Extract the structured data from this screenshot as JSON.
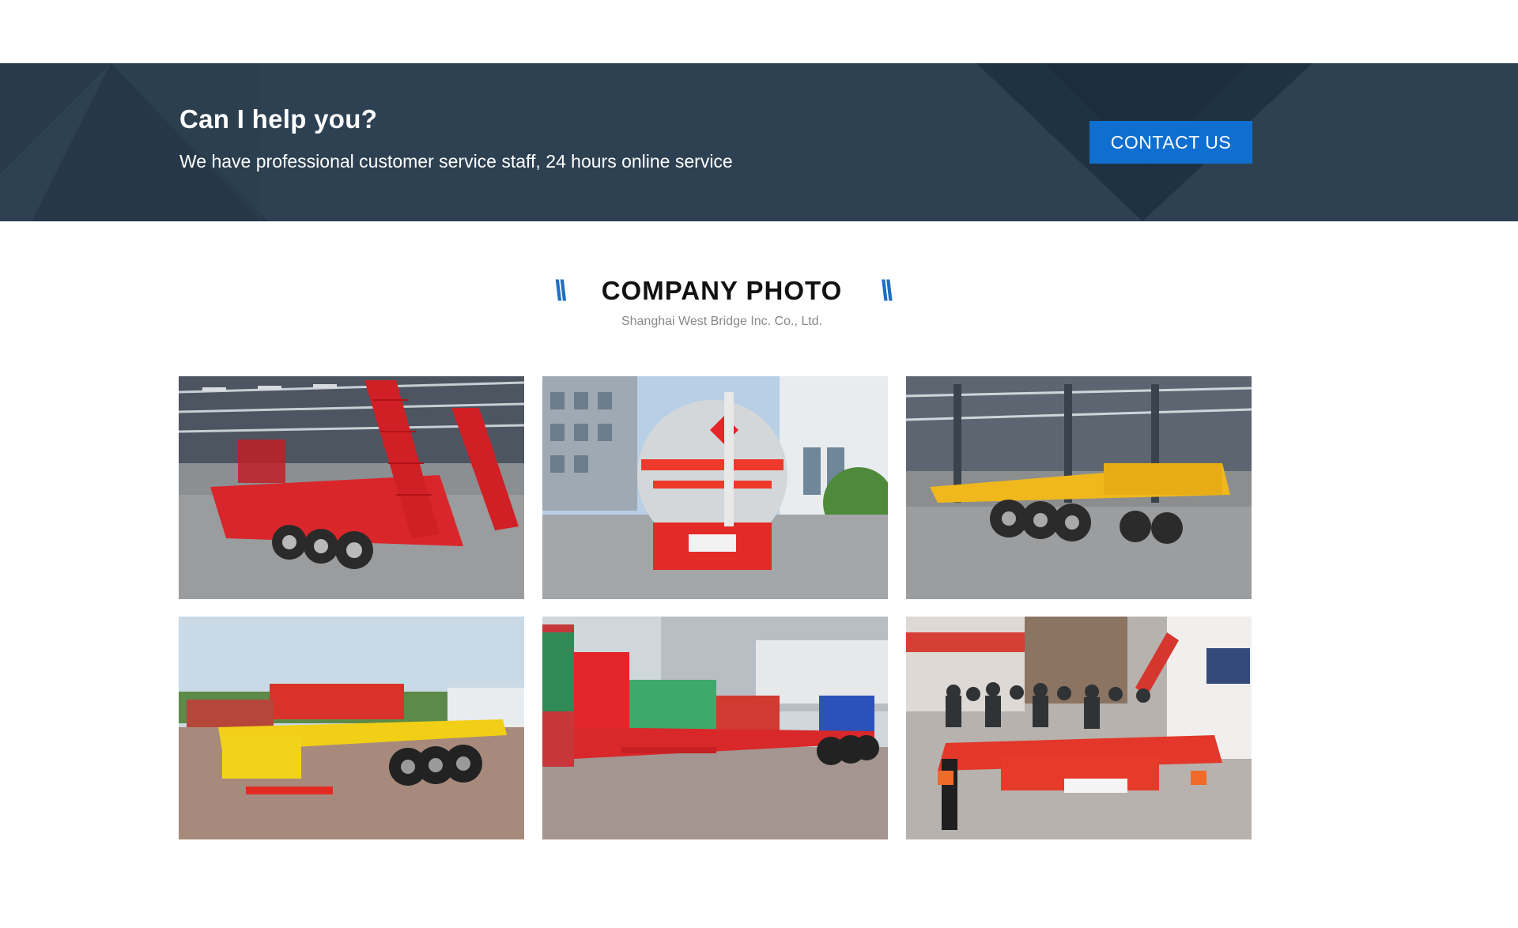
{
  "banner": {
    "title": "Can I help you?",
    "subtitle": "We have professional customer service staff, 24 hours online service",
    "contact_label": "CONTACT US"
  },
  "section": {
    "left_mark": "\\\\",
    "title": "COMPANY PHOTO",
    "right_mark": "\\\\",
    "subtitle": "Shanghai West Bridge Inc. Co., Ltd."
  },
  "colors": {
    "banner_bg": "#2e4152",
    "accent_blue": "#0f6fd0",
    "trailer_red": "#e23a2c",
    "trailer_yellow": "#f0b81c"
  },
  "photos": [
    {
      "icon": "lowbed-trailer-photo"
    },
    {
      "icon": "fuel-tanker-photo"
    },
    {
      "icon": "skeleton-trailer-photo"
    },
    {
      "icon": "yellow-flatbed-photo"
    },
    {
      "icon": "sidewall-trailer-photo"
    },
    {
      "icon": "exhibition-trailer-photo"
    }
  ]
}
